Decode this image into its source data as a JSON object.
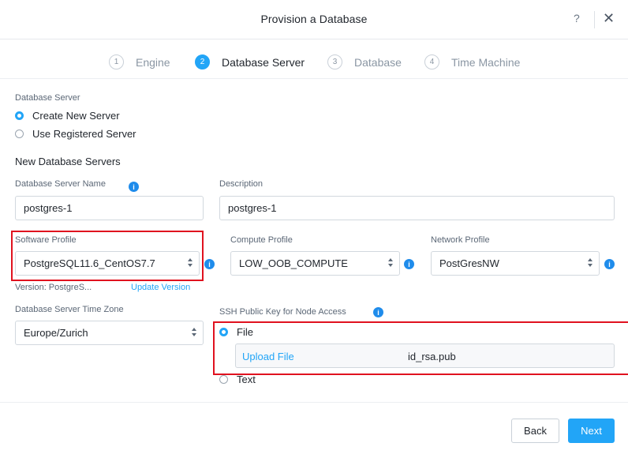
{
  "dialog": {
    "title": "Provision a Database",
    "help_label": "?",
    "close_label": "✕"
  },
  "steps": [
    {
      "number": "1",
      "label": "Engine",
      "active": false
    },
    {
      "number": "2",
      "label": "Database Server",
      "active": true
    },
    {
      "number": "3",
      "label": "Database",
      "active": false
    },
    {
      "number": "4",
      "label": "Time Machine",
      "active": false
    }
  ],
  "database_server": {
    "label": "Database Server",
    "options": [
      {
        "label": "Create New Server",
        "selected": true
      },
      {
        "label": "Use Registered Server",
        "selected": false
      }
    ]
  },
  "new_servers": {
    "section_title": "New Database Servers",
    "server_name": {
      "label": "Database Server Name",
      "value": "postgres-1"
    },
    "description": {
      "label": "Description",
      "value": "postgres-1"
    },
    "software_profile": {
      "label": "Software Profile",
      "value": "PostgreSQL11.6_CentOS7.7"
    },
    "compute_profile": {
      "label": "Compute Profile",
      "value": "LOW_OOB_COMPUTE"
    },
    "network_profile": {
      "label": "Network Profile",
      "value": "PostGresNW"
    },
    "version_text": "Version:  PostgreS...",
    "update_version_label": "Update Version",
    "time_zone": {
      "label": "Database Server Time Zone",
      "value": "Europe/Zurich"
    },
    "ssh_key": {
      "label": "SSH Public Key for Node Access",
      "options": [
        {
          "label": "File",
          "selected": true
        },
        {
          "label": "Text",
          "selected": false
        }
      ],
      "upload_label": "Upload File",
      "file_name": "id_rsa.pub"
    }
  },
  "info_icon_glyph": "i",
  "footer": {
    "back_label": "Back",
    "next_label": "Next"
  },
  "colors": {
    "accent": "#22a5f7",
    "info": "#1f8ceb",
    "highlight": "#e0121f"
  }
}
